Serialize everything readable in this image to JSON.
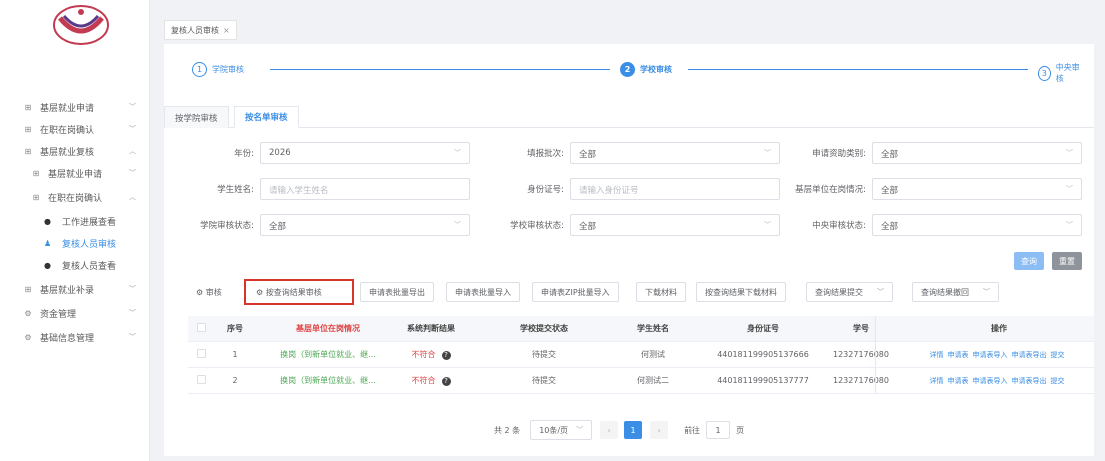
{
  "sidebar": {
    "items": [
      {
        "label": "基层就业申请"
      },
      {
        "label": "在职在岗确认"
      },
      {
        "label": "基层就业复核"
      },
      {
        "label": "基层就业申请"
      },
      {
        "label": "在职在岗确认"
      },
      {
        "label": "工作进展查看"
      },
      {
        "label": "复核人员审核"
      },
      {
        "label": "复核人员查看"
      },
      {
        "label": "基层就业补录"
      },
      {
        "label": "资金管理"
      },
      {
        "label": "基础信息管理"
      }
    ]
  },
  "tab": {
    "label": "复核人员审核",
    "close": "×"
  },
  "steps": [
    {
      "num": "1",
      "label": "学院审核"
    },
    {
      "num": "2",
      "label": "学校审核"
    },
    {
      "num": "3",
      "label": "中央审核"
    }
  ],
  "subtabs": [
    {
      "label": "按学院审核"
    },
    {
      "label": "按名单审核"
    }
  ],
  "filters": {
    "year": {
      "label": "年份:",
      "value": "2026"
    },
    "batch": {
      "label": "填报批次:",
      "value": "全部"
    },
    "aid_type": {
      "label": "申请资助类别:",
      "value": "全部"
    },
    "name": {
      "label": "学生姓名:",
      "placeholder": "请输入学生姓名"
    },
    "idno": {
      "label": "身份证号:",
      "placeholder": "请输入身份证号"
    },
    "onjob": {
      "label": "基层单位在岗情况:",
      "value": "全部"
    },
    "college_status": {
      "label": "学院审核状态:",
      "value": "全部"
    },
    "school_status": {
      "label": "学校审核状态:",
      "value": "全部"
    },
    "central_status": {
      "label": "中央审核状态:",
      "value": "全部"
    }
  },
  "buttons": {
    "query": "查询",
    "reset": "重置"
  },
  "toolbar": {
    "audit": "审核",
    "audit_by_result": "按查询结果审核",
    "export_batch": "申请表批量导出",
    "import_batch": "申请表批量导入",
    "import_zip": "申请表ZIP批量导入",
    "download": "下载材料",
    "download_by_result": "按查询结果下载材料",
    "submit_by_result": "查询结果提交",
    "withdraw_by_result": "查询结果撤回"
  },
  "table": {
    "headers": [
      "序号",
      "基层单位在岗情况",
      "系统判断结果",
      "学校提交状态",
      "学生姓名",
      "身份证号",
      "学号",
      "操作"
    ],
    "rows": [
      {
        "no": "1",
        "status": "换岗（到新单位就业、继...",
        "judge": "不符合",
        "submit": "待提交",
        "name": "何测试",
        "id": "440181199905137666",
        "sid": "12327176080"
      },
      {
        "no": "2",
        "status": "换岗（到新单位就业、继...",
        "judge": "不符合",
        "submit": "待提交",
        "name": "何测试二",
        "id": "440181199905137777",
        "sid": "12327176080"
      }
    ],
    "actions": [
      "详情",
      "申请表",
      "申请表导入",
      "申请表导出",
      "提交"
    ]
  },
  "pager": {
    "total": "共 2 条",
    "size": "10条/页",
    "current": "1",
    "goto": "前往",
    "goto_value": "1",
    "page_unit": "页"
  },
  "colors": {
    "accent": "#3a8ee6",
    "danger": "#e04545",
    "success": "#4aa852",
    "highlight": "#d9342b"
  }
}
